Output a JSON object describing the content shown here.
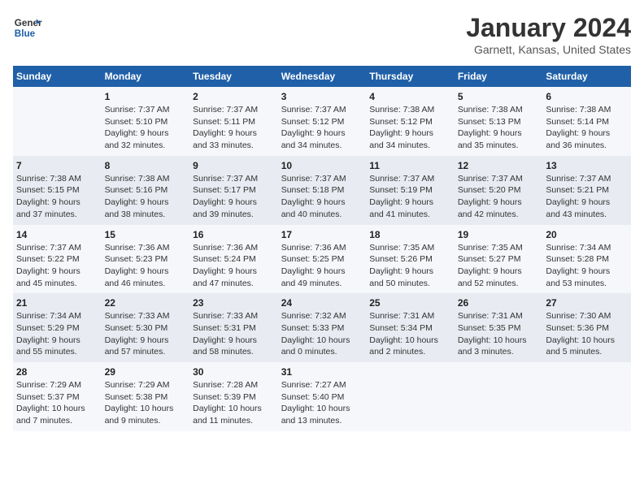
{
  "header": {
    "logo_line1": "General",
    "logo_line2": "Blue",
    "month": "January 2024",
    "location": "Garnett, Kansas, United States"
  },
  "weekdays": [
    "Sunday",
    "Monday",
    "Tuesday",
    "Wednesday",
    "Thursday",
    "Friday",
    "Saturday"
  ],
  "weeks": [
    [
      {
        "day": "",
        "info": ""
      },
      {
        "day": "1",
        "info": "Sunrise: 7:37 AM\nSunset: 5:10 PM\nDaylight: 9 hours\nand 32 minutes."
      },
      {
        "day": "2",
        "info": "Sunrise: 7:37 AM\nSunset: 5:11 PM\nDaylight: 9 hours\nand 33 minutes."
      },
      {
        "day": "3",
        "info": "Sunrise: 7:37 AM\nSunset: 5:12 PM\nDaylight: 9 hours\nand 34 minutes."
      },
      {
        "day": "4",
        "info": "Sunrise: 7:38 AM\nSunset: 5:12 PM\nDaylight: 9 hours\nand 34 minutes."
      },
      {
        "day": "5",
        "info": "Sunrise: 7:38 AM\nSunset: 5:13 PM\nDaylight: 9 hours\nand 35 minutes."
      },
      {
        "day": "6",
        "info": "Sunrise: 7:38 AM\nSunset: 5:14 PM\nDaylight: 9 hours\nand 36 minutes."
      }
    ],
    [
      {
        "day": "7",
        "info": "Sunrise: 7:38 AM\nSunset: 5:15 PM\nDaylight: 9 hours\nand 37 minutes."
      },
      {
        "day": "8",
        "info": "Sunrise: 7:38 AM\nSunset: 5:16 PM\nDaylight: 9 hours\nand 38 minutes."
      },
      {
        "day": "9",
        "info": "Sunrise: 7:37 AM\nSunset: 5:17 PM\nDaylight: 9 hours\nand 39 minutes."
      },
      {
        "day": "10",
        "info": "Sunrise: 7:37 AM\nSunset: 5:18 PM\nDaylight: 9 hours\nand 40 minutes."
      },
      {
        "day": "11",
        "info": "Sunrise: 7:37 AM\nSunset: 5:19 PM\nDaylight: 9 hours\nand 41 minutes."
      },
      {
        "day": "12",
        "info": "Sunrise: 7:37 AM\nSunset: 5:20 PM\nDaylight: 9 hours\nand 42 minutes."
      },
      {
        "day": "13",
        "info": "Sunrise: 7:37 AM\nSunset: 5:21 PM\nDaylight: 9 hours\nand 43 minutes."
      }
    ],
    [
      {
        "day": "14",
        "info": "Sunrise: 7:37 AM\nSunset: 5:22 PM\nDaylight: 9 hours\nand 45 minutes."
      },
      {
        "day": "15",
        "info": "Sunrise: 7:36 AM\nSunset: 5:23 PM\nDaylight: 9 hours\nand 46 minutes."
      },
      {
        "day": "16",
        "info": "Sunrise: 7:36 AM\nSunset: 5:24 PM\nDaylight: 9 hours\nand 47 minutes."
      },
      {
        "day": "17",
        "info": "Sunrise: 7:36 AM\nSunset: 5:25 PM\nDaylight: 9 hours\nand 49 minutes."
      },
      {
        "day": "18",
        "info": "Sunrise: 7:35 AM\nSunset: 5:26 PM\nDaylight: 9 hours\nand 50 minutes."
      },
      {
        "day": "19",
        "info": "Sunrise: 7:35 AM\nSunset: 5:27 PM\nDaylight: 9 hours\nand 52 minutes."
      },
      {
        "day": "20",
        "info": "Sunrise: 7:34 AM\nSunset: 5:28 PM\nDaylight: 9 hours\nand 53 minutes."
      }
    ],
    [
      {
        "day": "21",
        "info": "Sunrise: 7:34 AM\nSunset: 5:29 PM\nDaylight: 9 hours\nand 55 minutes."
      },
      {
        "day": "22",
        "info": "Sunrise: 7:33 AM\nSunset: 5:30 PM\nDaylight: 9 hours\nand 57 minutes."
      },
      {
        "day": "23",
        "info": "Sunrise: 7:33 AM\nSunset: 5:31 PM\nDaylight: 9 hours\nand 58 minutes."
      },
      {
        "day": "24",
        "info": "Sunrise: 7:32 AM\nSunset: 5:33 PM\nDaylight: 10 hours\nand 0 minutes."
      },
      {
        "day": "25",
        "info": "Sunrise: 7:31 AM\nSunset: 5:34 PM\nDaylight: 10 hours\nand 2 minutes."
      },
      {
        "day": "26",
        "info": "Sunrise: 7:31 AM\nSunset: 5:35 PM\nDaylight: 10 hours\nand 3 minutes."
      },
      {
        "day": "27",
        "info": "Sunrise: 7:30 AM\nSunset: 5:36 PM\nDaylight: 10 hours\nand 5 minutes."
      }
    ],
    [
      {
        "day": "28",
        "info": "Sunrise: 7:29 AM\nSunset: 5:37 PM\nDaylight: 10 hours\nand 7 minutes."
      },
      {
        "day": "29",
        "info": "Sunrise: 7:29 AM\nSunset: 5:38 PM\nDaylight: 10 hours\nand 9 minutes."
      },
      {
        "day": "30",
        "info": "Sunrise: 7:28 AM\nSunset: 5:39 PM\nDaylight: 10 hours\nand 11 minutes."
      },
      {
        "day": "31",
        "info": "Sunrise: 7:27 AM\nSunset: 5:40 PM\nDaylight: 10 hours\nand 13 minutes."
      },
      {
        "day": "",
        "info": ""
      },
      {
        "day": "",
        "info": ""
      },
      {
        "day": "",
        "info": ""
      }
    ]
  ]
}
